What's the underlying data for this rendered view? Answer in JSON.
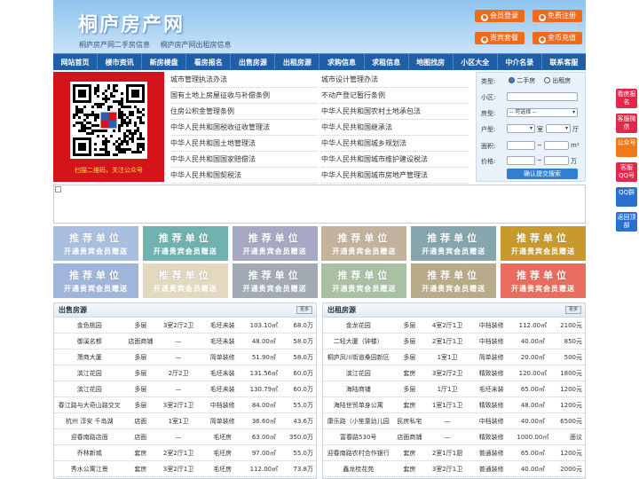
{
  "header": {
    "logo": "桐庐房产网",
    "subtitle": [
      "桐庐房产网二手房信息",
      "桐庐房产网出租房信息"
    ],
    "buttons": [
      {
        "label": "会员登录",
        "icon": "user-icon"
      },
      {
        "label": "免费注册",
        "icon": "register-icon"
      },
      {
        "label": "贵宾套餐",
        "icon": "vip-icon"
      },
      {
        "label": "金币充值",
        "icon": "coin-icon"
      }
    ]
  },
  "nav": [
    "网站首页",
    "楼市资讯",
    "新房楼盘",
    "看房报名",
    "出售房源",
    "出租房源",
    "求购信息",
    "求租信息",
    "地图找房",
    "小区大全",
    "中介名录",
    "联系客服"
  ],
  "qr": {
    "caption": "扫描二维码，关注公众号"
  },
  "links": [
    [
      "城市管理执法办法",
      "城市设计管理办法"
    ],
    [
      "国有土地上房屋征收与补偿条例",
      "不动产登记暂行条例"
    ],
    [
      "住房公积金管理条例",
      "中华人民共和国农村土地承包法"
    ],
    [
      "中华人民共和国税收征收管理法",
      "中华人民共和国继承法"
    ],
    [
      "中华人民共和国土地管理法",
      "中华人民共和国城乡规划法"
    ],
    [
      "中华人民共和国国家赔偿法",
      "中华人民共和国城市维护建设税法"
    ],
    [
      "中华人民共和国契税法",
      "中华人民共和国城市房地产管理法"
    ]
  ],
  "search": {
    "type_label": "类型:",
    "opt1": "二手房",
    "opt2": "出租房",
    "community_label": "小区:",
    "houseType_label": "房型:",
    "houseType_value": "-- 可选择 --",
    "layout_label": "户型:",
    "room_unit": "室",
    "hall_unit": "厅",
    "area_label": "面积:",
    "area_unit": "m²",
    "price_label": "价格:",
    "price_unit": "万",
    "tilde": "~",
    "submit": "确认提交搜索"
  },
  "ads": {
    "line1": "推荐单位",
    "line2": "开通贵宾会员赠送",
    "colors": [
      "#a9bfe0",
      "#6fb2b0",
      "#a6a8c4",
      "#c3b39c",
      "#86a6ad",
      "#c89a2e",
      "#9fb6da",
      "#e2d9bf",
      "#a2aab4",
      "#a9c0a4",
      "#b8ab8a",
      "#e86d5e"
    ]
  },
  "sale": {
    "title": "出售房源",
    "more": "更多",
    "rows": [
      [
        "金色桃园",
        "多层",
        "3室2厅2卫",
        "毛坯未装",
        "103.10㎡",
        "68.0万"
      ],
      [
        "御溪名都",
        "店面商铺",
        "—",
        "毛坯未装",
        "48.00㎡",
        "58.0万"
      ],
      [
        "萧商大厦",
        "多层",
        "—",
        "简单装修",
        "51.90㎡",
        "58.0万"
      ],
      [
        "滨江花园",
        "多层",
        "2厅2卫",
        "毛坯未装",
        "131.56㎡",
        "60.0万"
      ],
      [
        "滨江花园",
        "多层",
        "—",
        "毛坯未装",
        "130.79㎡",
        "60.0万"
      ],
      [
        "春江路与大奇山路交叉",
        "多层",
        "3室2厅1卫",
        "中档装修",
        "84.00㎡",
        "55.0万"
      ],
      [
        "杭州 淳安 千岛湖",
        "店面",
        "1室1卫",
        "简单装修",
        "36.60㎡",
        "43.6万"
      ],
      [
        "迎春南路店面",
        "店面",
        "—",
        "毛坯房",
        "63.00㎡",
        "350.0万"
      ],
      [
        "乔林新城",
        "套房",
        "2室2厅1卫",
        "毛坯房",
        "97.00㎡",
        "55.0万"
      ],
      [
        "秀水公寓江景",
        "套房",
        "3室2厅1卫",
        "毛坯房",
        "112.00㎡",
        "73.8万"
      ]
    ]
  },
  "rent": {
    "title": "出租房源",
    "more": "更多",
    "rows": [
      [
        "金龙花园",
        "多层",
        "4室2厅1卫",
        "中档装修",
        "112.00㎡",
        "2100元"
      ],
      [
        "二轻大厦（钟楼）",
        "多层",
        "2室1厅1卫",
        "中档装修",
        "40.00㎡",
        "850元"
      ],
      [
        "桐庐凤川街道桑园新区",
        "多层",
        "1室1卫",
        "简单装修",
        "20.00㎡",
        "500元"
      ],
      [
        "滨江花园",
        "套房",
        "3室2厅2卫",
        "精致装修",
        "120.00㎡",
        "1800元"
      ],
      [
        "海陆商铺",
        "多层",
        "1厅1卫",
        "毛坯未装",
        "65.00㎡",
        "1200元"
      ],
      [
        "海陆世贸单身公寓",
        "套房",
        "1室1厅1卫",
        "精致装修",
        "48.00㎡",
        "1200元"
      ],
      [
        "康乐路（小笙童幼儿园",
        "民房私宅",
        "—",
        "中档装修",
        "40.00㎡",
        "6500元"
      ],
      [
        "富春路530号",
        "店面商铺",
        "—",
        "精致装修",
        "1000.00㎡",
        "面议"
      ],
      [
        "迎春南路农村合作银行",
        "套房",
        "2室1厅1厨",
        "普通装修",
        "65.00㎡",
        "1200元"
      ],
      [
        "鑫龙桂花苑",
        "套房",
        "3室2厅1卫",
        "普通装修",
        "40.00㎡",
        "2000元"
      ]
    ]
  },
  "side": [
    {
      "label": "看房报名",
      "color": "#e0284a"
    },
    {
      "label": "客服微信",
      "color": "#e0284a"
    },
    {
      "label": "公众号",
      "color": "#f07a1a"
    },
    {
      "label": "客服QQ号",
      "color": "#e0284a"
    },
    {
      "label": "QQ群",
      "color": "#2b6fd0"
    },
    {
      "label": "返回顶部",
      "color": "#2b6fd0"
    }
  ]
}
